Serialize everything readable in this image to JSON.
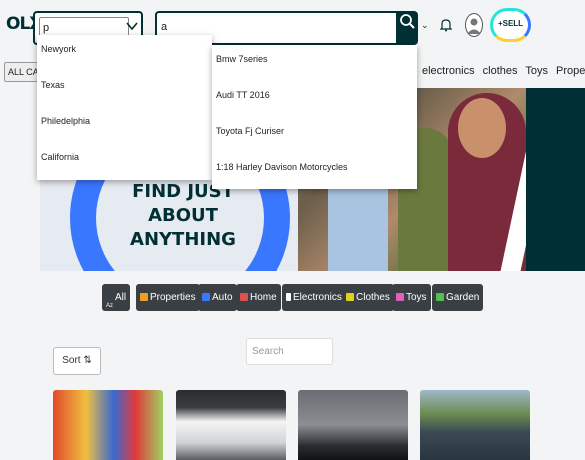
{
  "header": {
    "logo": "OLX",
    "location_value": "p",
    "search_value": "a",
    "sell_label": "SELL"
  },
  "location_options": [
    "Newyork",
    "Texas",
    "Philedelphia",
    "California"
  ],
  "search_suggestions": [
    "Bmw 7series",
    "Audi TT 2016",
    "Toyota Fj Curiser",
    "1:18 Harley Davison Motorcycles"
  ],
  "catbar": {
    "all_categories": "ALL CATE",
    "links": [
      "electronics",
      "clothes",
      "Toys",
      "Properties"
    ]
  },
  "banner": {
    "line1": "FIND JUST ABOUT",
    "line2": "ANYTHING"
  },
  "filters": [
    {
      "label": "All",
      "icon": "az-icon",
      "color": "#ffffff"
    },
    {
      "label": "Properties",
      "icon": "home-icon",
      "color": "#f0a020"
    },
    {
      "label": "Auto",
      "icon": "car-icon",
      "color": "#3a77ff"
    },
    {
      "label": "Home",
      "icon": "house-icon",
      "color": "#e05050"
    },
    {
      "label": "Electronics",
      "icon": "phone-icon",
      "color": "#ffffff"
    },
    {
      "label": "Clothes",
      "icon": "shirt-icon",
      "color": "#e0d020"
    },
    {
      "label": "Toys",
      "icon": "toy-icon",
      "color": "#e060c0"
    },
    {
      "label": "Garden",
      "icon": "plant-icon",
      "color": "#50c050"
    }
  ],
  "sort_label": "Sort",
  "list_search_placeholder": "Search"
}
